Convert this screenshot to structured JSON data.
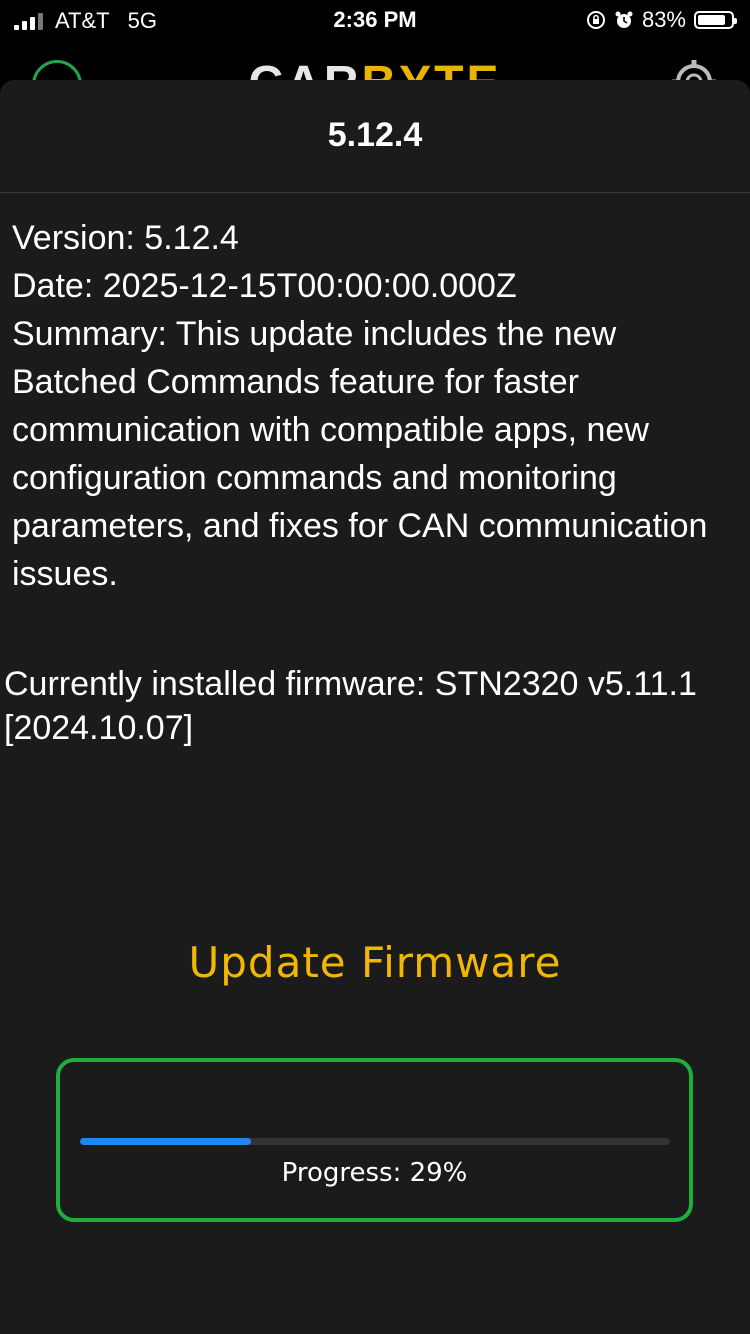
{
  "status_bar": {
    "carrier": "AT&T",
    "network": "5G",
    "time": "2:36 PM",
    "battery_percent": "83%",
    "battery_level": 0.83,
    "icons": [
      "signal-icon",
      "orientation-lock-icon",
      "alarm-icon",
      "battery-icon"
    ]
  },
  "app_header": {
    "logo_part1": "CAR",
    "logo_part2": "BYTE",
    "left_icon": "car-icon",
    "right_icon": "gear-icon"
  },
  "sheet": {
    "title": "5.12.4",
    "version_line": "Version: 5.12.4",
    "date_line": "Date: 2025-12-15T00:00:00.000Z",
    "summary_line": "Summary: This update includes the new Batched Commands feature for faster communication with compatible apps, new configuration commands and monitoring parameters, and fixes for CAN communication issues.",
    "installed_line": "Currently installed firmware: STN2320 v5.11.1 [2024.10.07]",
    "update_button": "Update Firmware",
    "progress_label": "Progress: 29%",
    "progress_value": 0.29
  },
  "colors": {
    "accent": "#f2b705",
    "progress_border": "#1fad3e",
    "progress_fill": "#1e88f5",
    "sheet_bg": "#1b1b1b"
  }
}
